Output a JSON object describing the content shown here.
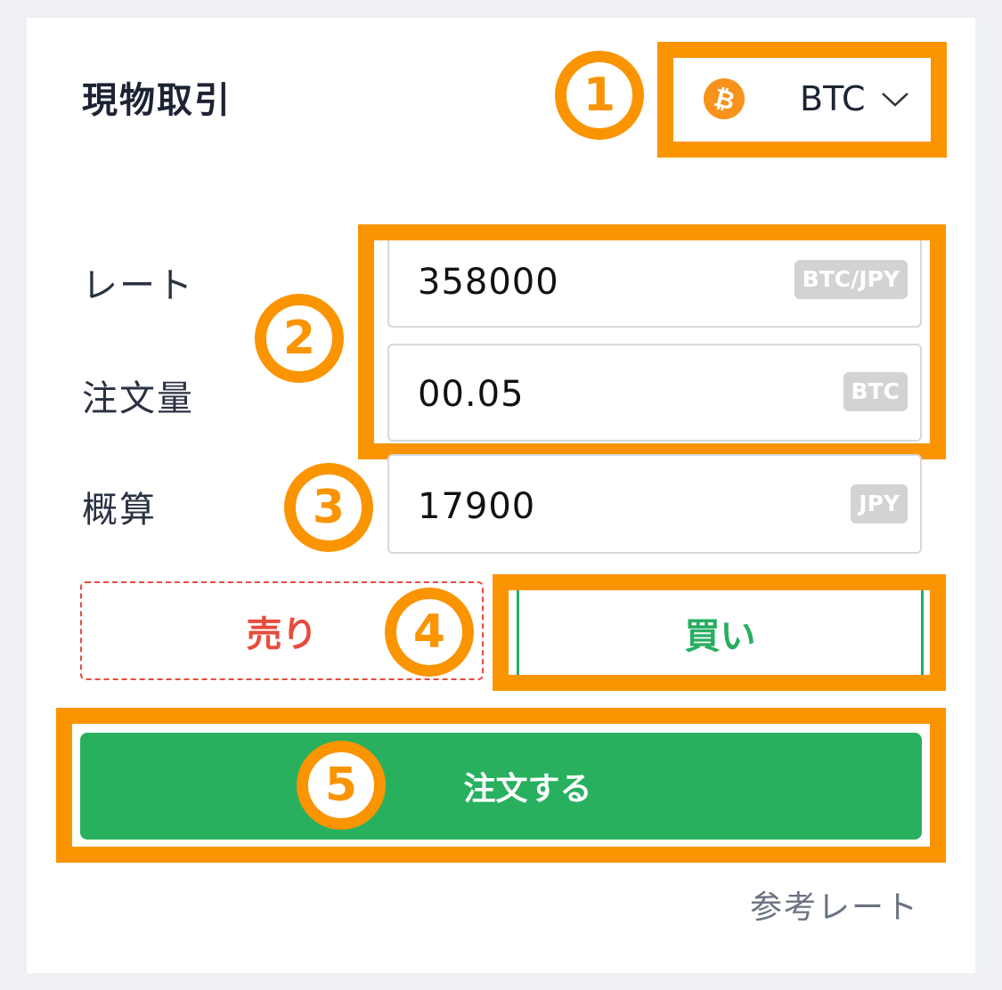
{
  "header": {
    "title": "現物取引"
  },
  "currency": {
    "symbol": "BTC",
    "icon": "bitcoin-icon",
    "dropdown_icon": "chevron-down-icon",
    "coin_glyph": "₿"
  },
  "form": {
    "rate": {
      "label": "レート",
      "value": "358000",
      "unit": "BTC/JPY"
    },
    "amount": {
      "label": "注文量",
      "value": "00.05",
      "unit": "BTC"
    },
    "estimate": {
      "label": "概算",
      "value": "17900",
      "unit": "JPY"
    }
  },
  "side": {
    "sell_label": "売り",
    "buy_label": "買い"
  },
  "order_button": {
    "label": "注文する"
  },
  "reference_link": "参考レート",
  "annotations": [
    "1",
    "2",
    "3",
    "4",
    "5"
  ],
  "colors": {
    "highlight": "#fb9401",
    "sell": "#e74c3c",
    "buy": "#27ae60",
    "order_button": "#28b05f",
    "bitcoin": "#f7931a"
  }
}
